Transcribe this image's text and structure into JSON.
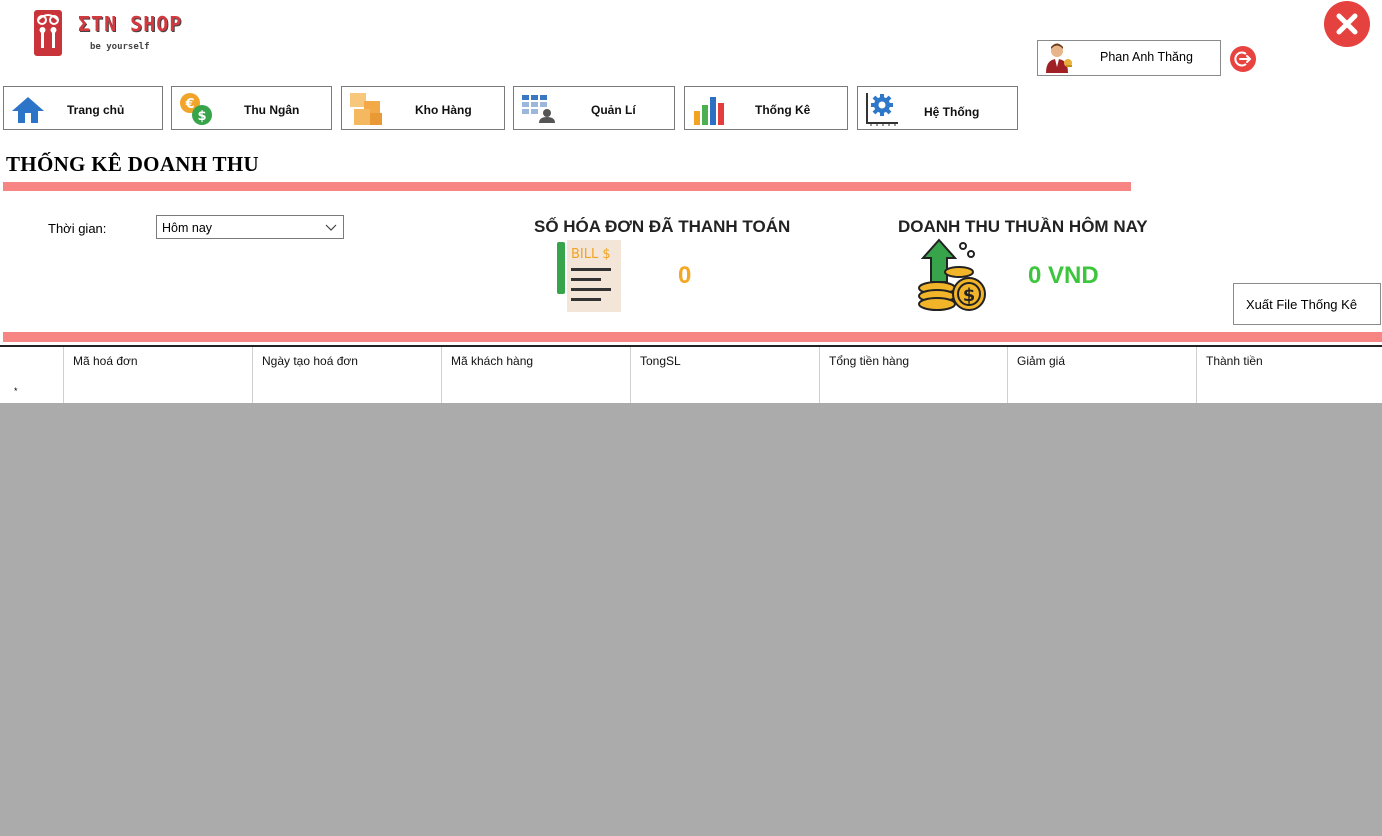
{
  "brand": {
    "name": "ƩTN SHOP",
    "tagline": "be yourself"
  },
  "user": {
    "name": "Phan Anh Thăng"
  },
  "nav": [
    {
      "label": "Trang chủ",
      "icon": "home-icon"
    },
    {
      "label": "Thu Ngân",
      "icon": "currency-exchange-icon"
    },
    {
      "label": "Kho Hàng",
      "icon": "boxes-icon"
    },
    {
      "label": "Quản Lí",
      "icon": "user-management-icon"
    },
    {
      "label": "Thống Kê",
      "icon": "bar-chart-icon"
    },
    {
      "label": "Hệ Thống",
      "icon": "settings-icon"
    }
  ],
  "page": {
    "title": "THỐNG KÊ DOANH THU"
  },
  "filter": {
    "label": "Thời gian:",
    "selected": "Hôm nay"
  },
  "stats": {
    "invoices": {
      "title": "SỐ HÓA ĐƠN ĐÃ THANH TOÁN",
      "value": "0",
      "color": "#f5a623"
    },
    "revenue": {
      "title": "DOANH THU THUẦN HÔM NAY",
      "value": "0 VND",
      "color": "#3dc53d"
    }
  },
  "bill_icon_text": "BILL $",
  "export": {
    "label": "Xuất File Thống Kê"
  },
  "grid": {
    "columns": [
      "Mã hoá đơn",
      "Ngày tạo hoá đơn",
      "Mã khách hàng",
      "TongSL",
      "Tổng tiền hàng",
      "Giảm giá",
      "Thành tiền"
    ],
    "new_row_marker": "*"
  },
  "colors": {
    "accent_bar": "#f78584",
    "close": "#e5413f",
    "grid_bg": "#ababab"
  }
}
